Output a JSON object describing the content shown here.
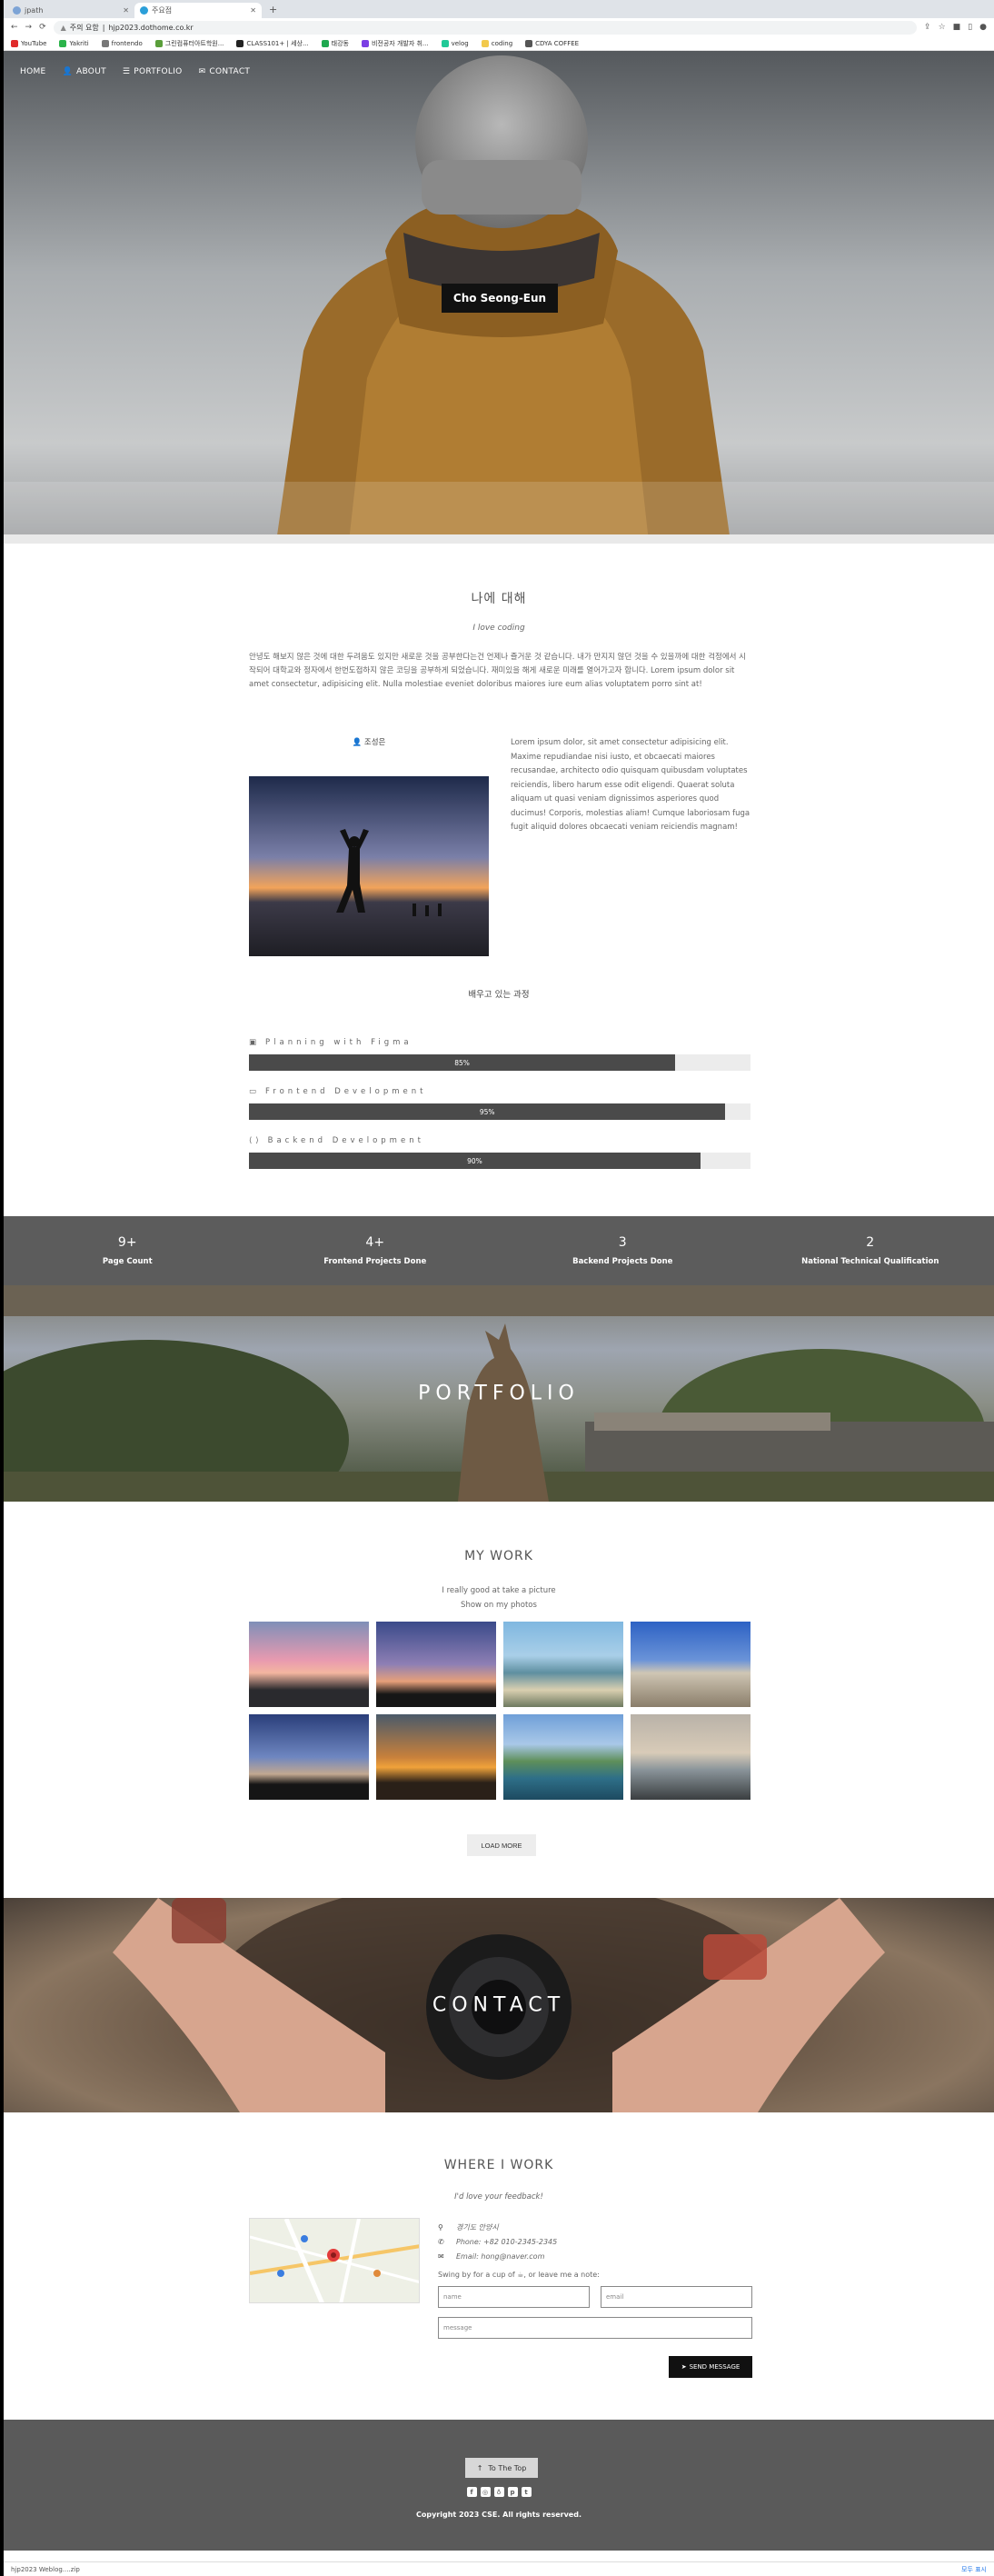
{
  "browser": {
    "tabs": [
      {
        "label": "jpath",
        "active": false
      },
      {
        "label": "주요점",
        "active": true
      }
    ],
    "new_tab": "+",
    "url_warning": "주의 요함",
    "url": "hjp2023.dothome.co.kr",
    "bookmarks": [
      "YouTube",
      "Yakriti",
      "frontendo",
      "그린컴퓨터아트학원...",
      "CLASS101+ | 세상...",
      "태강동",
      "비전공자 개발자 취...",
      "velog",
      "coding",
      "CDYA COFFEE"
    ]
  },
  "nav": {
    "items": [
      {
        "label": "HOME",
        "icon": ""
      },
      {
        "label": "ABOUT",
        "icon": "user-icon"
      },
      {
        "label": "PORTFOLIO",
        "icon": "list-icon"
      },
      {
        "label": "CONTACT",
        "icon": "mail-icon"
      }
    ]
  },
  "hero": {
    "title": "Cho Seong-Eun"
  },
  "about": {
    "title": "나에 대해",
    "subtitle": "I love coding",
    "intro": "안녕도 해보지 않은 것에 대한 두려움도 있지만 새로운 것을 공부한다는건 언제나 즐거운 것 같습니다. 내가 만지지 않던 것을 수 있을까에 대한 걱정에서 시작되어 대학교와 정자에서 한번도접하지 않은 코딩을 공부하게 되었습니다. 재미있을 해게 새로운 미래를 열어가고자 합니다. Lorem ipsum dolor sit amet consectetur, adipisicing elit. Nulla molestiae eveniet doloribus maiores iure eum alias voluptatem porro sint at!",
    "profile_name": "조성은",
    "profile_text": "Lorem ipsum dolor, sit amet consectetur adipisicing elit. Maxime repudiandae nisi iusto, et obcaecati maiores recusandae, architecto odio quisquam quibusdam voluptates reiciendis, libero harum esse odit eligendi. Quaerat soluta aliquam ut quasi veniam dignissimos asperiores quod ducimus! Corporis, molestias aliam! Cumque laboriosam fuga fugit aliquid dolores obcaecati veniam reiciendis magnam!",
    "skills_title": "배우고 있는 과정",
    "skills": [
      {
        "label": "Planning with Figma",
        "percent_text": "85%",
        "percent": 85,
        "icon": "figma-icon"
      },
      {
        "label": "Frontend Development",
        "percent_text": "95%",
        "percent": 95,
        "icon": "monitor-icon"
      },
      {
        "label": "Backend Development",
        "percent_text": "90%",
        "percent": 90,
        "icon": "code-icon"
      }
    ]
  },
  "stats": [
    {
      "num": "9+",
      "label": "Page Count"
    },
    {
      "num": "4+",
      "label": "Frontend Projects Done"
    },
    {
      "num": "3",
      "label": "Backend Projects Done"
    },
    {
      "num": "2",
      "label": "National Technical Qualification"
    }
  ],
  "portfolio": {
    "banner_title": "PORTFOLIO",
    "title": "MY WORK",
    "sub1": "I really good at take a picture",
    "sub2": "Show on my photos",
    "load_more": "LOAD MORE"
  },
  "contact": {
    "banner_title": "CONTACT",
    "title": "WHERE I WORK",
    "subtitle": "I'd love your feedback!",
    "address": "경기도 안양시",
    "phone": "Phone: +82 010-2345-2345",
    "email": "Email: hong@naver.com",
    "swing": "Swing by for a cup of ☕, or leave me a note:",
    "name_placeholder": "name",
    "email_placeholder": "email",
    "message_placeholder": "message",
    "send": "SEND MESSAGE"
  },
  "footer": {
    "to_top": "To The Top",
    "copyright": "Copyright 2023 CSE. All rights reserved.",
    "socials": [
      "facebook-icon",
      "instagram-icon",
      "snapchat-icon",
      "pinterest-icon",
      "twitter-icon"
    ]
  },
  "downloads": {
    "file": "hjp2023 Weblog....zip",
    "show_all": "모두 표시"
  }
}
